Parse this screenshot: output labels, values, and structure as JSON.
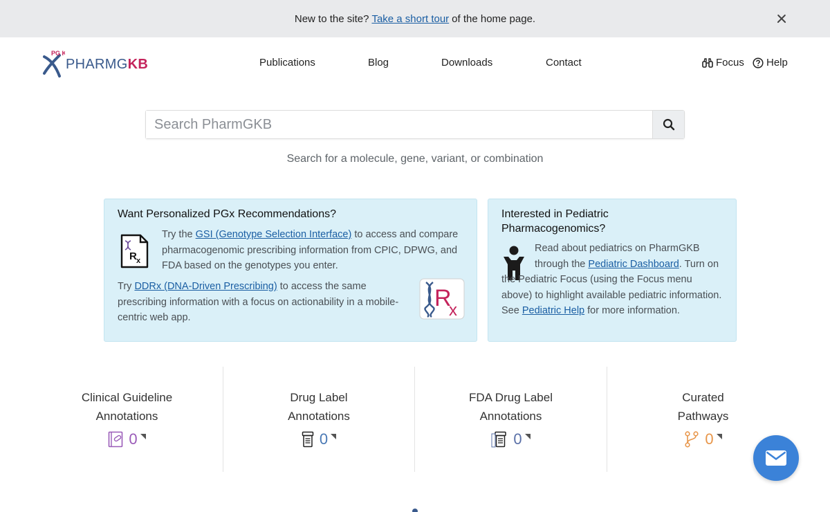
{
  "banner": {
    "prefix": "New to the site?",
    "link": "Take a short tour",
    "suffix": "of the home page."
  },
  "header": {
    "logo_mark_text": "PG KB",
    "logo_text_plain": "PHARMG",
    "logo_text_bold": "KB",
    "nav": [
      "Publications",
      "Blog",
      "Downloads",
      "Contact"
    ],
    "focus_label": "Focus",
    "help_label": "Help"
  },
  "search": {
    "placeholder": "Search PharmGKB",
    "value": "",
    "hint": "Search for a molecule, gene, variant, or combination"
  },
  "cards": {
    "pgx": {
      "title": "Want Personalized PGx Recommendations?",
      "p1_pre": "Try the",
      "p1_link": "GSI (Genotype Selection Interface)",
      "p1_post": "to access and compare pharmacogenomic prescribing information from CPIC, DPWG, and FDA based on the genotypes you enter.",
      "p2_pre": "Try",
      "p2_link": "DDRx (DNA-Driven Prescribing)",
      "p2_post": "to access the same prescribing information with a focus on actionability in a mobile-centric web app."
    },
    "pediatric": {
      "title": "Interested in Pediatric Pharmacogenomics?",
      "t1": "Read about pediatrics on PharmGKB through the",
      "link1": "Pediatric Dashboard",
      "t2": ". Turn on the Pediatric Focus (using the Focus menu above) to highlight available pediatric information. See",
      "link2": "Pediatric Help",
      "t3": "for more information."
    }
  },
  "stats": [
    {
      "title_line1": "Clinical Guideline",
      "title_line2": "Annotations",
      "count": "0",
      "icon": "clipboard-pill-icon",
      "color": "#9a5bb8"
    },
    {
      "title_line1": "Drug Label",
      "title_line2": "Annotations",
      "count": "0",
      "icon": "pill-bottle-icon",
      "color": "#4a79b5"
    },
    {
      "title_line1": "FDA Drug Label",
      "title_line2": "Annotations",
      "count": "0",
      "icon": "fda-label-icon",
      "color": "#5a70a8"
    },
    {
      "title_line1": "Curated",
      "title_line2": "Pathways",
      "count": "0",
      "icon": "pathway-icon",
      "color": "#e8964a"
    }
  ],
  "colors": {
    "accent": "#1a5ea3",
    "brand_red": "#c4235b",
    "card_bg": "#daf0f8",
    "fab": "#3b82d8"
  }
}
